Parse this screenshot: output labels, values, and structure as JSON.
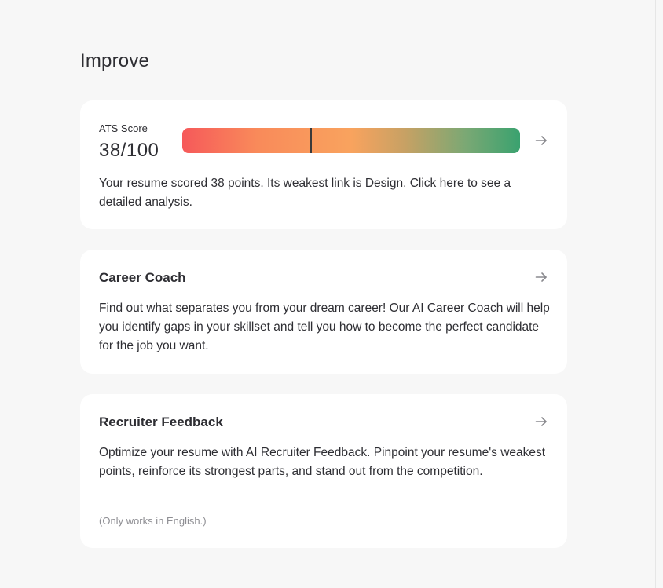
{
  "page": {
    "title": "Improve"
  },
  "ats": {
    "label": "ATS Score",
    "score_text": "38/100",
    "score_fraction": 0.38,
    "description": "Your resume scored 38 points. Its weakest link is Design. Click here to see a detailed analysis.",
    "gradient_colors": [
      "#f6595a",
      "#f98a5a",
      "#f9a35e",
      "#c7a164",
      "#7aa874",
      "#3aa26f"
    ]
  },
  "career_coach": {
    "title": "Career Coach",
    "description": "Find out what separates you from your dream career! Our AI Career Coach will help you identify gaps in your skillset and tell you how to become the perfect candidate for the job you want."
  },
  "recruiter_feedback": {
    "title": "Recruiter Feedback",
    "description": "Optimize your resume with AI Recruiter Feedback. Pinpoint your resume's weakest points, reinforce its strongest parts, and stand out from the competition.",
    "note": "(Only works in English.)"
  },
  "icons": {
    "card_arrow": "arrow-right-icon"
  }
}
